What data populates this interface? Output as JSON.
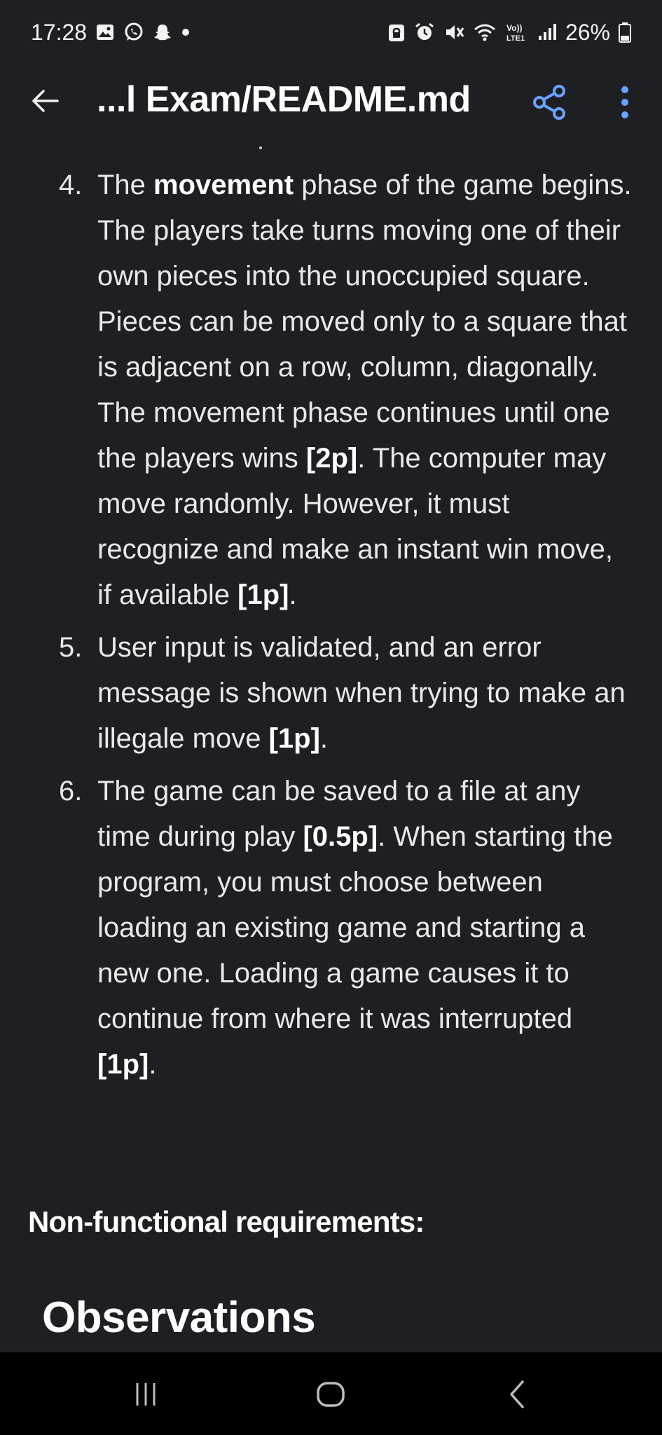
{
  "status_bar": {
    "time": "17:28",
    "left_icons": [
      "gallery-icon",
      "whatsapp-icon",
      "snapchat-icon",
      "dot-icon"
    ],
    "right_icons": [
      "lock-icon",
      "alarm-icon",
      "mute-icon",
      "wifi-icon",
      "volte-icon",
      "signal-icon"
    ],
    "battery": "26%"
  },
  "app_bar": {
    "title": "...l Exam/README.md",
    "back_icon": "arrow-left-icon",
    "share_icon": "share-icon",
    "more_icon": "more-vert-icon"
  },
  "requirements": [
    {
      "number": "4.",
      "parts": [
        {
          "text": "The ",
          "bold": false
        },
        {
          "text": "movement",
          "bold": true
        },
        {
          "text": " phase of the game begins. The players take turns moving one of their own pieces into the unoccupied square. Pieces can be moved only to a square that is adjacent on a row, column, diagonally. The movement phase continues until one the players wins ",
          "bold": false
        },
        {
          "text": "[2p]",
          "bold": true
        },
        {
          "text": ". The computer may move randomly. However, it must recognize and make an instant win move, if available ",
          "bold": false
        },
        {
          "text": "[1p]",
          "bold": true
        },
        {
          "text": ".",
          "bold": false
        }
      ]
    },
    {
      "number": "5.",
      "parts": [
        {
          "text": "User input is validated, and an error message is shown when trying to make an illegale move ",
          "bold": false
        },
        {
          "text": "[1p]",
          "bold": true
        },
        {
          "text": ".",
          "bold": false
        }
      ]
    },
    {
      "number": "6.",
      "parts": [
        {
          "text": "The game can be saved to a file at any time during play ",
          "bold": false
        },
        {
          "text": "[0.5p]",
          "bold": true
        },
        {
          "text": ". When starting the program, you must choose between loading an existing game and starting a new one. Loading a game causes it to continue from where it was interrupted ",
          "bold": false
        },
        {
          "text": "[1p]",
          "bold": true
        },
        {
          "text": ".",
          "bold": false
        }
      ]
    }
  ],
  "non_functional_heading": "Non-functional requirements:",
  "observations_heading": "Observations",
  "nav_bar": {
    "icons": [
      "recent-apps-icon",
      "home-icon",
      "back-icon"
    ]
  }
}
